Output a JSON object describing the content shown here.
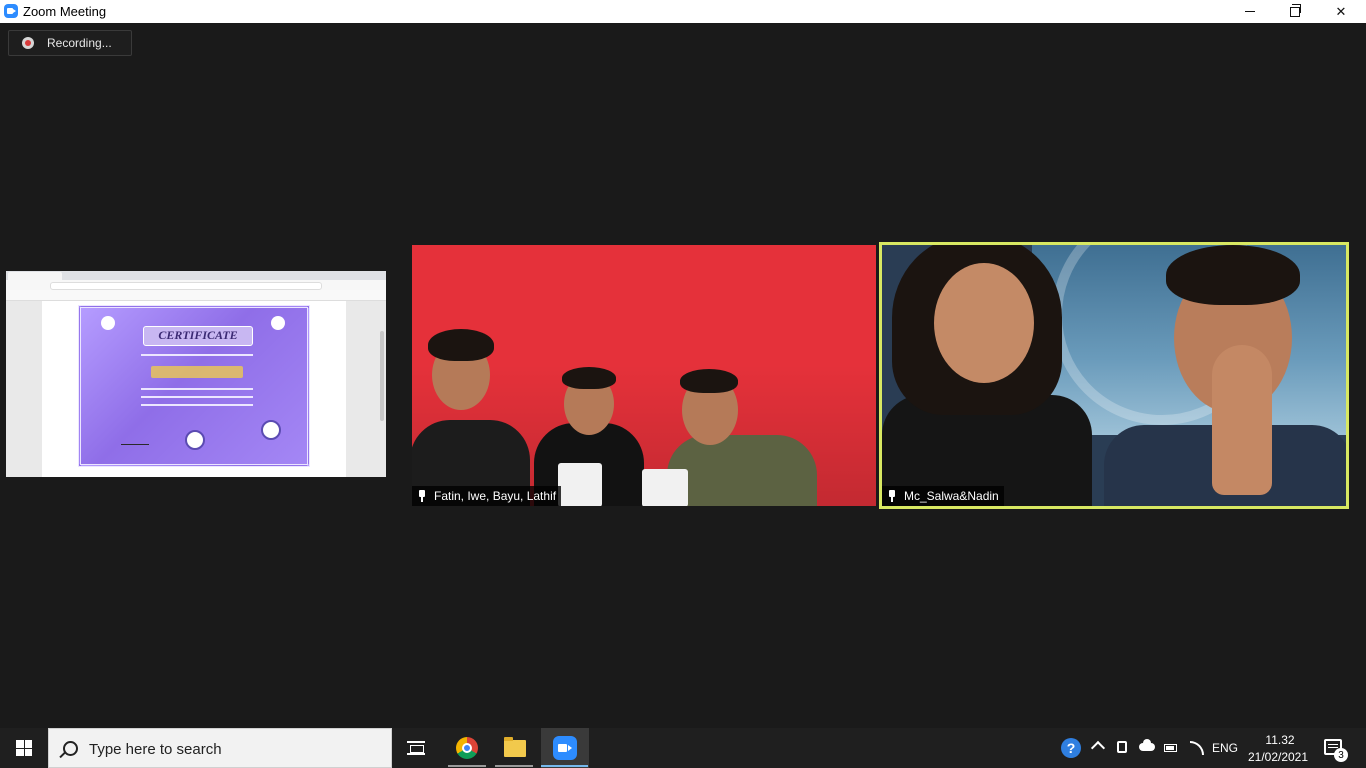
{
  "window": {
    "title": "Zoom Meeting"
  },
  "recording": {
    "label": "Recording..."
  },
  "participants": [
    {
      "name": "Fatin, Iwe, Bayu, Lathif"
    },
    {
      "name": "Mc_Salwa&Nadin"
    }
  ],
  "shared_screen": {
    "certificate_heading": "CERTIFICATE"
  },
  "taskbar": {
    "search_placeholder": "Type here to search",
    "language": "ENG",
    "time": "11.32",
    "date": "21/02/2021",
    "notification_count": "3",
    "apps": [
      "chrome-icon",
      "file-explorer-icon",
      "zoom-icon"
    ]
  },
  "colors": {
    "accent_speaker_border": "#d8e862",
    "zoom_blue": "#2d8cff",
    "recording_red": "#d83a3a"
  }
}
